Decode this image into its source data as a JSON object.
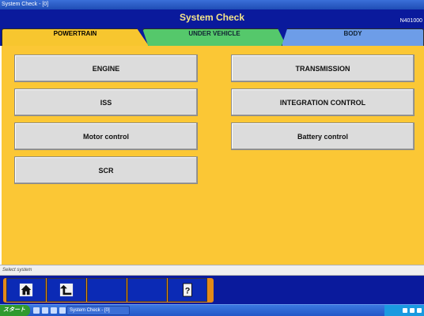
{
  "window": {
    "title": "System Check - [0]"
  },
  "header": {
    "title": "System Check",
    "code": "N401000"
  },
  "tabs": [
    {
      "label": "POWERTRAIN",
      "active": true
    },
    {
      "label": "UNDER VEHICLE",
      "active": false
    },
    {
      "label": "BODY",
      "active": false
    }
  ],
  "systems": {
    "engine": "ENGINE",
    "transmission": "TRANSMISSION",
    "iss": "ISS",
    "integration_control": "INTEGRATION CONTROL",
    "motor_control": "Motor control",
    "battery_control": "Battery control",
    "scr": "SCR"
  },
  "status": {
    "text": "Select system"
  },
  "toolbar": {
    "buttons": [
      {
        "icon": "home-icon"
      },
      {
        "icon": "back-up-arrow-icon"
      },
      {
        "icon": "blank"
      },
      {
        "icon": "blank"
      },
      {
        "icon": "help-icon",
        "label": "?"
      }
    ]
  },
  "taskbar": {
    "start_label": "スタート",
    "task_label": "System Check - [0]"
  },
  "colors": {
    "header_bg": "#0a1a9c",
    "title_text": "#f4e48a",
    "panel_yellow": "#fbc735",
    "tab_powertrain": "#f7c62f",
    "tab_under_vehicle": "#55c86b",
    "tab_body": "#6d9de8",
    "toolbar_orange": "#e48a18"
  }
}
